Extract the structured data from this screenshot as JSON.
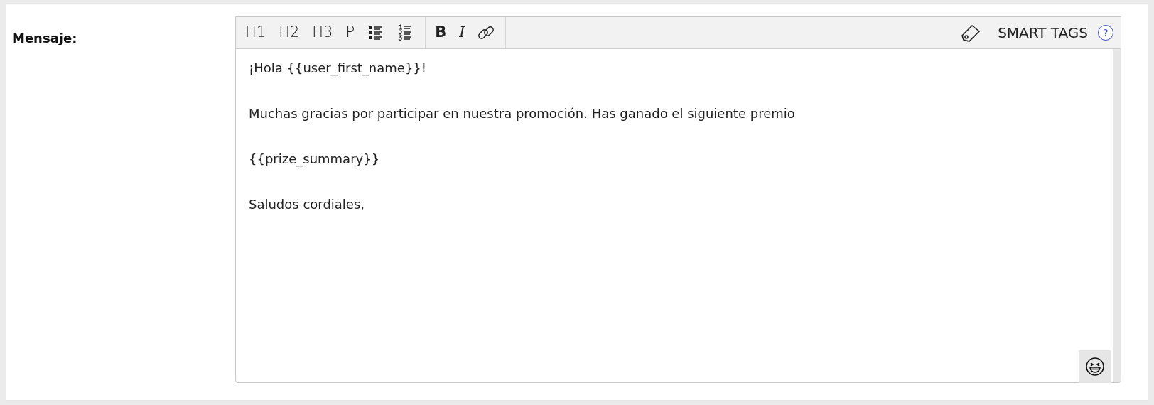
{
  "field_label": "Mensaje:",
  "toolbar": {
    "groups": [
      {
        "items": [
          {
            "kind": "text",
            "label": "H1"
          },
          {
            "kind": "text",
            "label": "H2"
          },
          {
            "kind": "text",
            "label": "H3"
          },
          {
            "kind": "text",
            "label": "P"
          },
          {
            "kind": "bullets"
          },
          {
            "kind": "numbers"
          }
        ]
      },
      {
        "items": [
          {
            "kind": "bold",
            "label": "B"
          },
          {
            "kind": "italic",
            "label": "I"
          },
          {
            "kind": "link"
          }
        ]
      }
    ],
    "smart_tags": "SMART TAGS",
    "help": "?"
  },
  "body": [
    "¡Hola {{user_first_name}}!",
    "Muchas gracias por participar en nuestra promoción. Has ganado el siguiente premio",
    "{{prize_summary}}",
    "Saludos cordiales,"
  ]
}
